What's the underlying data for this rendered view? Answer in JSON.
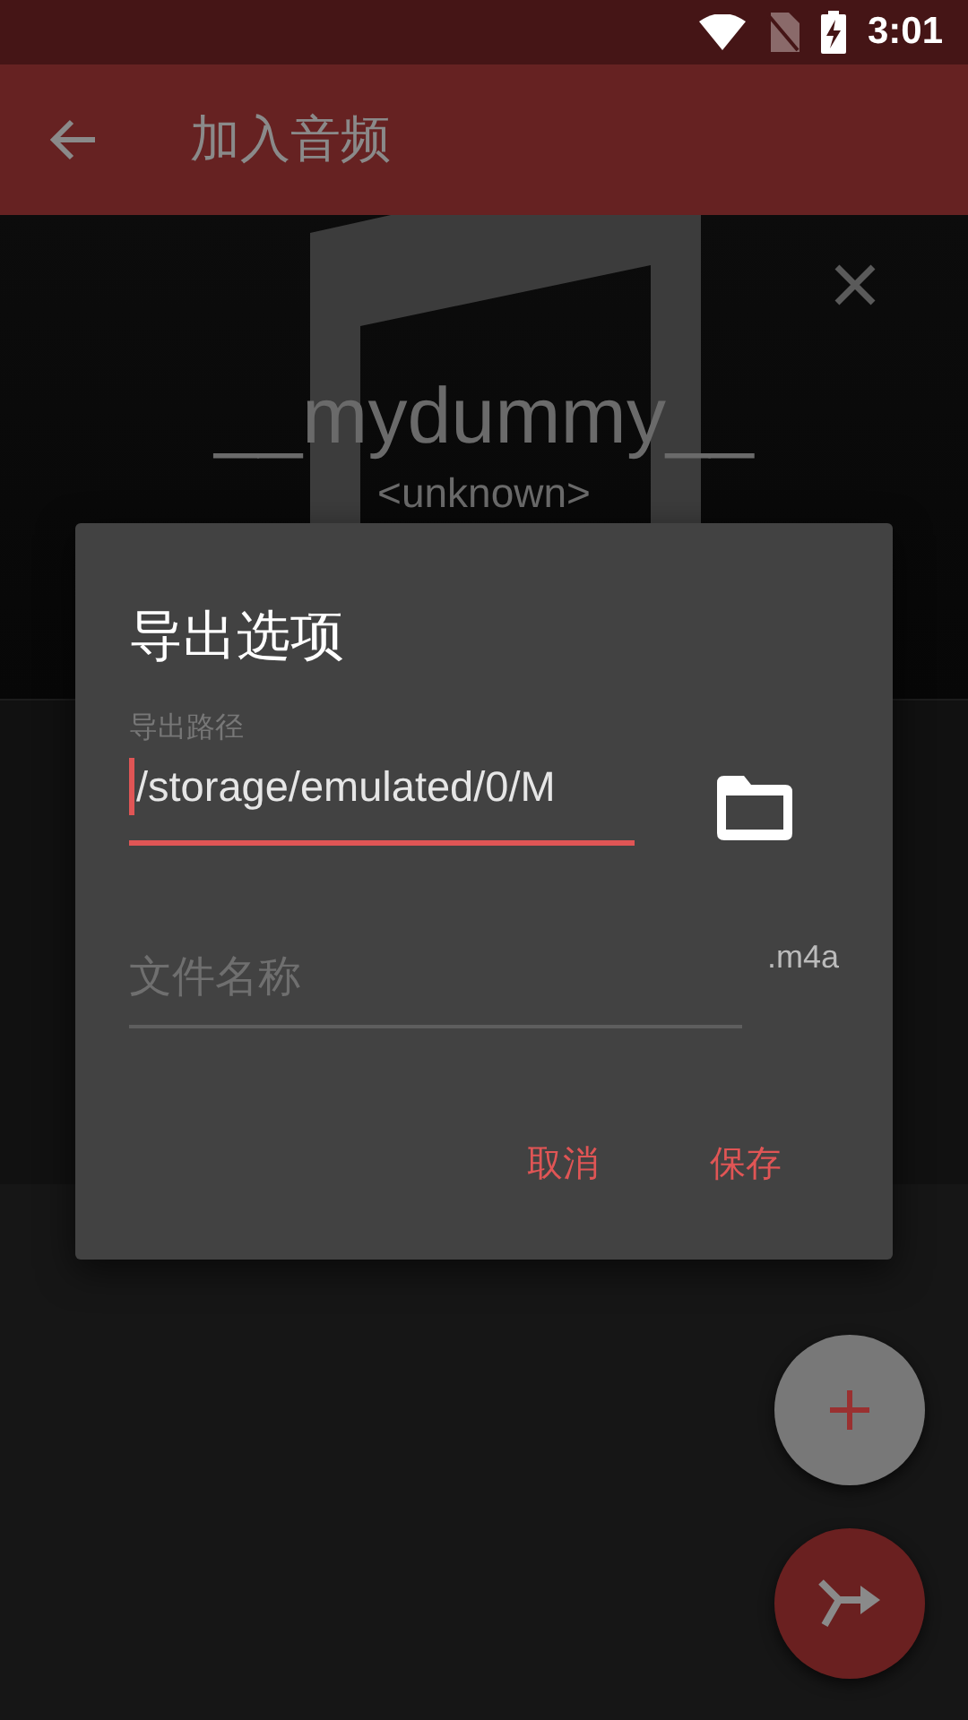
{
  "status_bar": {
    "time": "3:01"
  },
  "app_bar": {
    "title": "加入音频"
  },
  "track": {
    "title": "__mydummy__",
    "artist": "<unknown>"
  },
  "dialog": {
    "title": "导出选项",
    "fields": [
      {
        "kind": "path",
        "label": "导出路径",
        "value": "/storage/emulated/0/M",
        "focused": true
      },
      {
        "kind": "name",
        "placeholder": "文件名称",
        "suffix": ".m4a",
        "focused": false
      }
    ],
    "buttons": [
      "取消",
      "保存"
    ]
  }
}
